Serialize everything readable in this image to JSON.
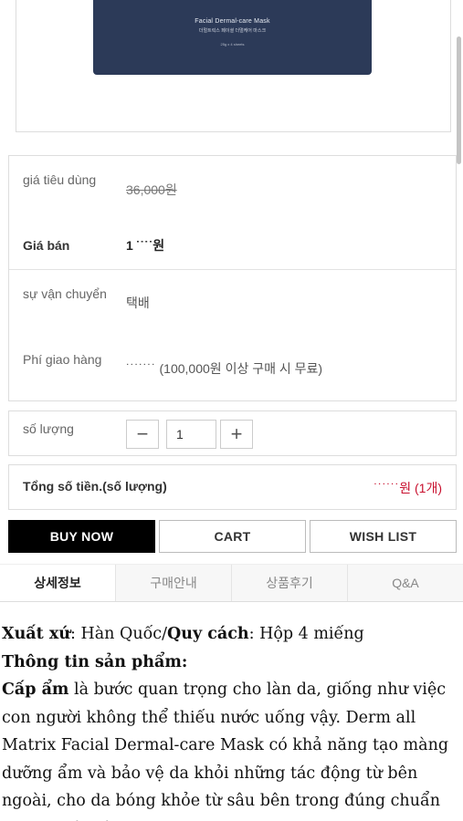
{
  "product_image": {
    "title": "Facial Dermal-care Mask",
    "subtitle": "더멀트릭스 페이셜 더멀케어 마스크",
    "count": "25g x 4 sheets"
  },
  "price_info": {
    "consumer_price_label": "giá tiêu dùng",
    "consumer_price_value": "36,000원",
    "sale_price_label": "Giá bán",
    "sale_price_value": "1 ˙˙˙˙원",
    "shipping_label": "sự vận chuyển",
    "shipping_value": "택배",
    "shipping_fee_label": "Phí giao hàng",
    "shipping_fee_value": "˙˙˙˙˙˙˙ (100,000원 이상 구매 시 무료)"
  },
  "quantity": {
    "label": "số lượng",
    "minus": "−",
    "value": "1",
    "plus": "+"
  },
  "total": {
    "label": "Tổng số tiền.(số lượng)",
    "value": "˙˙˙˙˙˙원 (1개)"
  },
  "actions": {
    "buy_now": "BUY NOW",
    "cart": "CART",
    "wish_list": "WISH LIST"
  },
  "tabs": [
    {
      "label": "상세정보",
      "active": true
    },
    {
      "label": "구매안내",
      "active": false
    },
    {
      "label": "상품후기",
      "active": false
    },
    {
      "label": "Q&A",
      "active": false
    }
  ],
  "description": {
    "origin_label": "Xuất xứ",
    "origin_value": ": Hàn Quốc/",
    "spec_label": "Quy cách",
    "spec_value": ": Hộp 4 miếng",
    "info_heading": "Thông tin sản phẩm:",
    "moisture_label": "Cấp ẩm",
    "moisture_text": " là bước quan trọng cho làn da, giống như việc con người không thể thiếu nước uống vậy. Derm all Matrix Facial Dermal-care Mask có khả năng tạo màng dưỡng ẩm và bảo vệ da khỏi những tác động từ bên ngoài, cho da bóng khỏe từ sâu bên trong đúng chuẩn da con gái Hàn."
  }
}
